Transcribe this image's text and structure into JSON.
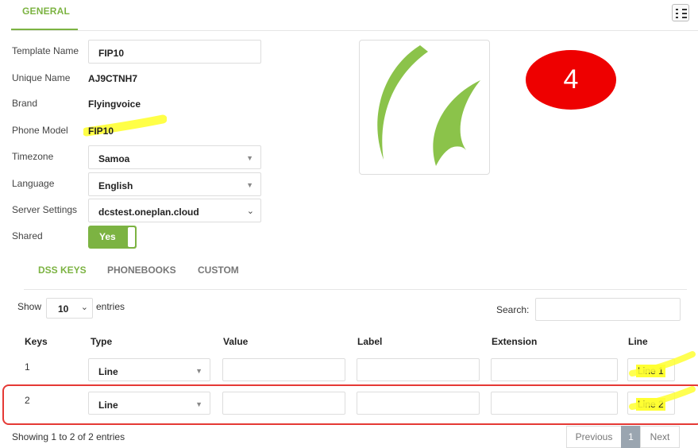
{
  "tabs": {
    "general": "GENERAL"
  },
  "form": {
    "template_name_label": "Template Name",
    "template_name_value": "FIP10",
    "unique_name_label": "Unique Name",
    "unique_name_value": "AJ9CTNH7",
    "brand_label": "Brand",
    "brand_value": "Flyingvoice",
    "phone_model_label": "Phone Model",
    "phone_model_value": "FIP10",
    "timezone_label": "Timezone",
    "timezone_value": "Samoa",
    "language_label": "Language",
    "language_value": "English",
    "server_label": "Server Settings",
    "server_value": "dcstest.oneplan.cloud",
    "shared_label": "Shared",
    "shared_value": "Yes"
  },
  "annotation": {
    "badge": "4"
  },
  "subtabs": [
    "DSS KEYS",
    "PHONEBOOKS",
    "CUSTOM"
  ],
  "table_controls": {
    "show_label": "Show",
    "entries_value": "10",
    "entries_label": "entries",
    "search_label": "Search:",
    "search_value": ""
  },
  "table": {
    "headers": [
      "Keys",
      "Type",
      "Value",
      "Label",
      "Extension",
      "Line"
    ],
    "rows": [
      {
        "key": "1",
        "type": "Line",
        "value": "",
        "label": "",
        "extension": "",
        "line": "Line 1"
      },
      {
        "key": "2",
        "type": "Line",
        "value": "",
        "label": "",
        "extension": "",
        "line": "Line 2"
      }
    ]
  },
  "footer": {
    "info": "Showing 1 to 2 of 2 entries",
    "previous": "Previous",
    "page": "1",
    "next": "Next"
  },
  "colors": {
    "accent": "#7cb342",
    "badge": "#ee0000",
    "highlight": "#ffff33",
    "frame": "#e53935"
  },
  "icons": [
    "list-menu-icon",
    "chevron-down-icon",
    "flyingvoice-logo"
  ]
}
